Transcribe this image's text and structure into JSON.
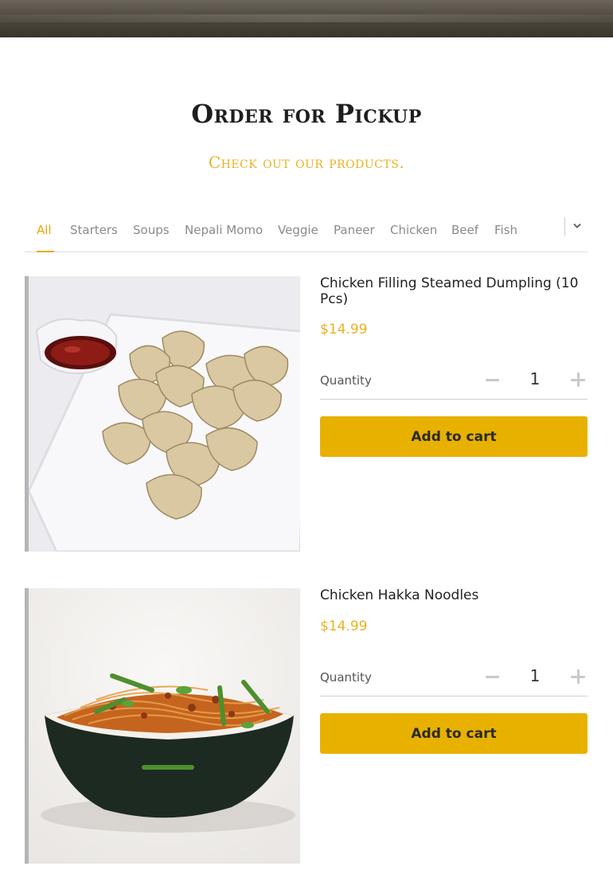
{
  "section": {
    "title": "Order for Pickup",
    "subtitle": "Check out our products."
  },
  "tabs": {
    "items": [
      "All",
      "Starters",
      "Soups",
      "Nepali Momo",
      "Veggie",
      "Paneer",
      "Chicken",
      "Beef",
      "Fish"
    ],
    "active": "All",
    "more_icon": "chevron-down-icon"
  },
  "products": [
    {
      "name": "Chicken Filling Steamed Dumpling (10 Pcs)",
      "price": "$14.99",
      "quantity_label": "Quantity",
      "quantity": "1",
      "add_label": "Add to cart",
      "image": "steamed-dumplings-photo"
    },
    {
      "name": "Chicken Hakka Noodles",
      "price": "$14.99",
      "quantity_label": "Quantity",
      "quantity": "1",
      "add_label": "Add to cart",
      "image": "hakka-noodles-photo"
    }
  ],
  "colors": {
    "accent": "#e8b100",
    "price": "#e8b321",
    "tab_active": "#e8a800"
  }
}
